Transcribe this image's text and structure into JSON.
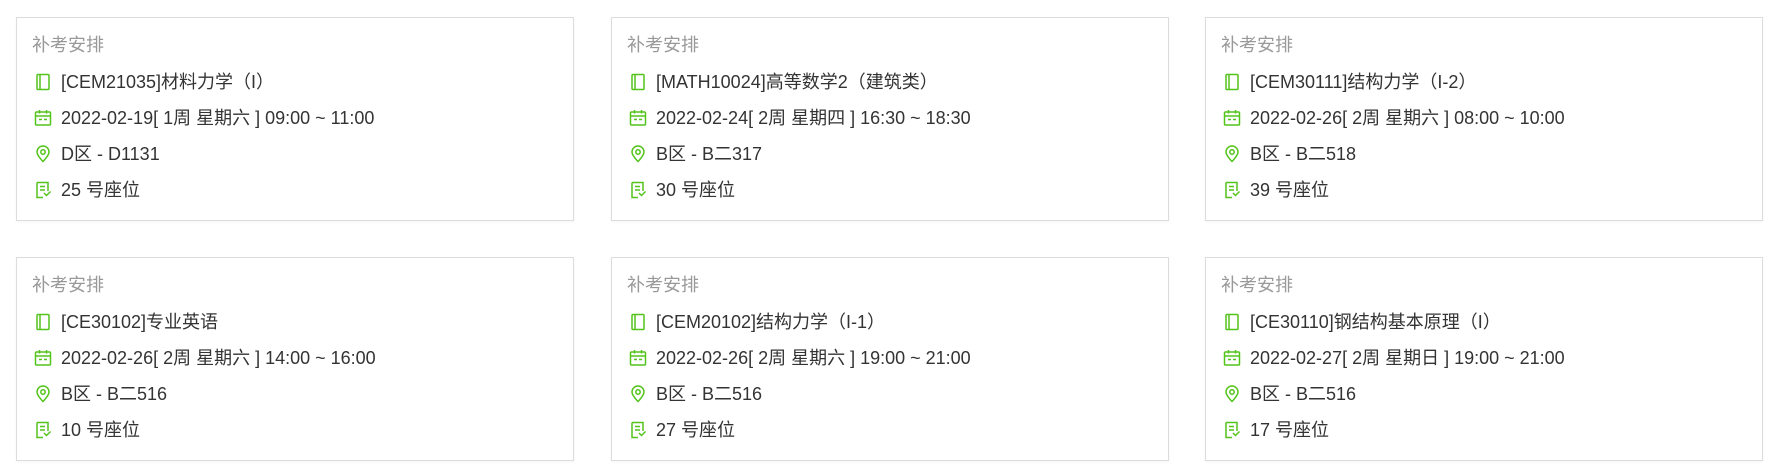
{
  "accent_color": "#52c41a",
  "icons": {
    "course": "book-icon",
    "time": "calendar-icon",
    "location": "location-pin-icon",
    "seat": "seat-receipt-icon"
  },
  "cards": [
    {
      "title": "补考安排",
      "course": "[CEM21035]材料力学（I）",
      "time": "2022-02-19[ 1周 星期六 ] 09:00 ~ 11:00",
      "location": "D区 - D1131",
      "seat": "25 号座位"
    },
    {
      "title": "补考安排",
      "course": "[MATH10024]高等数学2（建筑类）",
      "time": "2022-02-24[ 2周 星期四 ] 16:30 ~ 18:30",
      "location": "B区 - B二317",
      "seat": "30 号座位"
    },
    {
      "title": "补考安排",
      "course": "[CEM30111]结构力学（I-2）",
      "time": "2022-02-26[ 2周 星期六 ] 08:00 ~ 10:00",
      "location": "B区 - B二518",
      "seat": "39 号座位"
    },
    {
      "title": "补考安排",
      "course": "[CE30102]专业英语",
      "time": "2022-02-26[ 2周 星期六 ] 14:00 ~ 16:00",
      "location": "B区 - B二516",
      "seat": "10 号座位"
    },
    {
      "title": "补考安排",
      "course": "[CEM20102]结构力学（I-1）",
      "time": "2022-02-26[ 2周 星期六 ] 19:00 ~ 21:00",
      "location": "B区 - B二516",
      "seat": "27 号座位"
    },
    {
      "title": "补考安排",
      "course": "[CE30110]钢结构基本原理（I）",
      "time": "2022-02-27[ 2周 星期日 ] 19:00 ~ 21:00",
      "location": "B区 - B二516",
      "seat": "17 号座位"
    }
  ]
}
